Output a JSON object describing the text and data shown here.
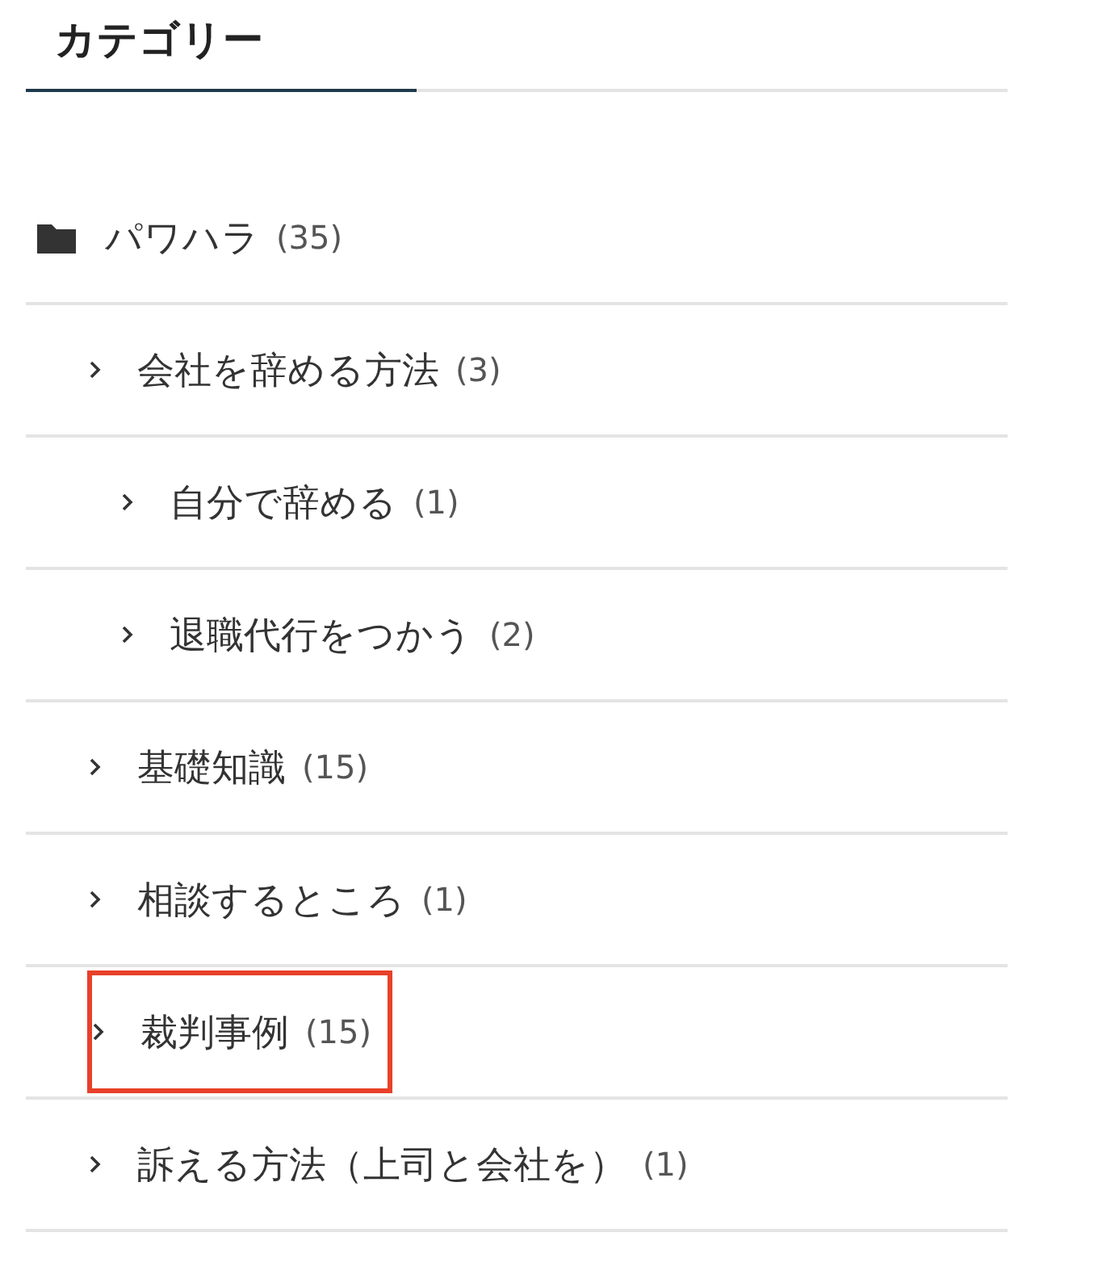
{
  "heading": "カテゴリー",
  "categories": [
    {
      "name": "パワハラ",
      "count": "(35)",
      "highlighted": false,
      "children": [
        {
          "name": "会社を辞める方法",
          "count": "(3)",
          "highlighted": false,
          "children": [
            {
              "name": "自分で辞める",
              "count": "(1)",
              "highlighted": false
            },
            {
              "name": "退職代行をつかう",
              "count": "(2)",
              "highlighted": false
            }
          ]
        },
        {
          "name": "基礎知識",
          "count": "(15)",
          "highlighted": false
        },
        {
          "name": "相談するところ",
          "count": "(1)",
          "highlighted": false
        },
        {
          "name": "裁判事例",
          "count": "(15)",
          "highlighted": true
        },
        {
          "name": "訴える方法（上司と会社を）",
          "count": "(1)",
          "highlighted": false
        }
      ]
    }
  ]
}
